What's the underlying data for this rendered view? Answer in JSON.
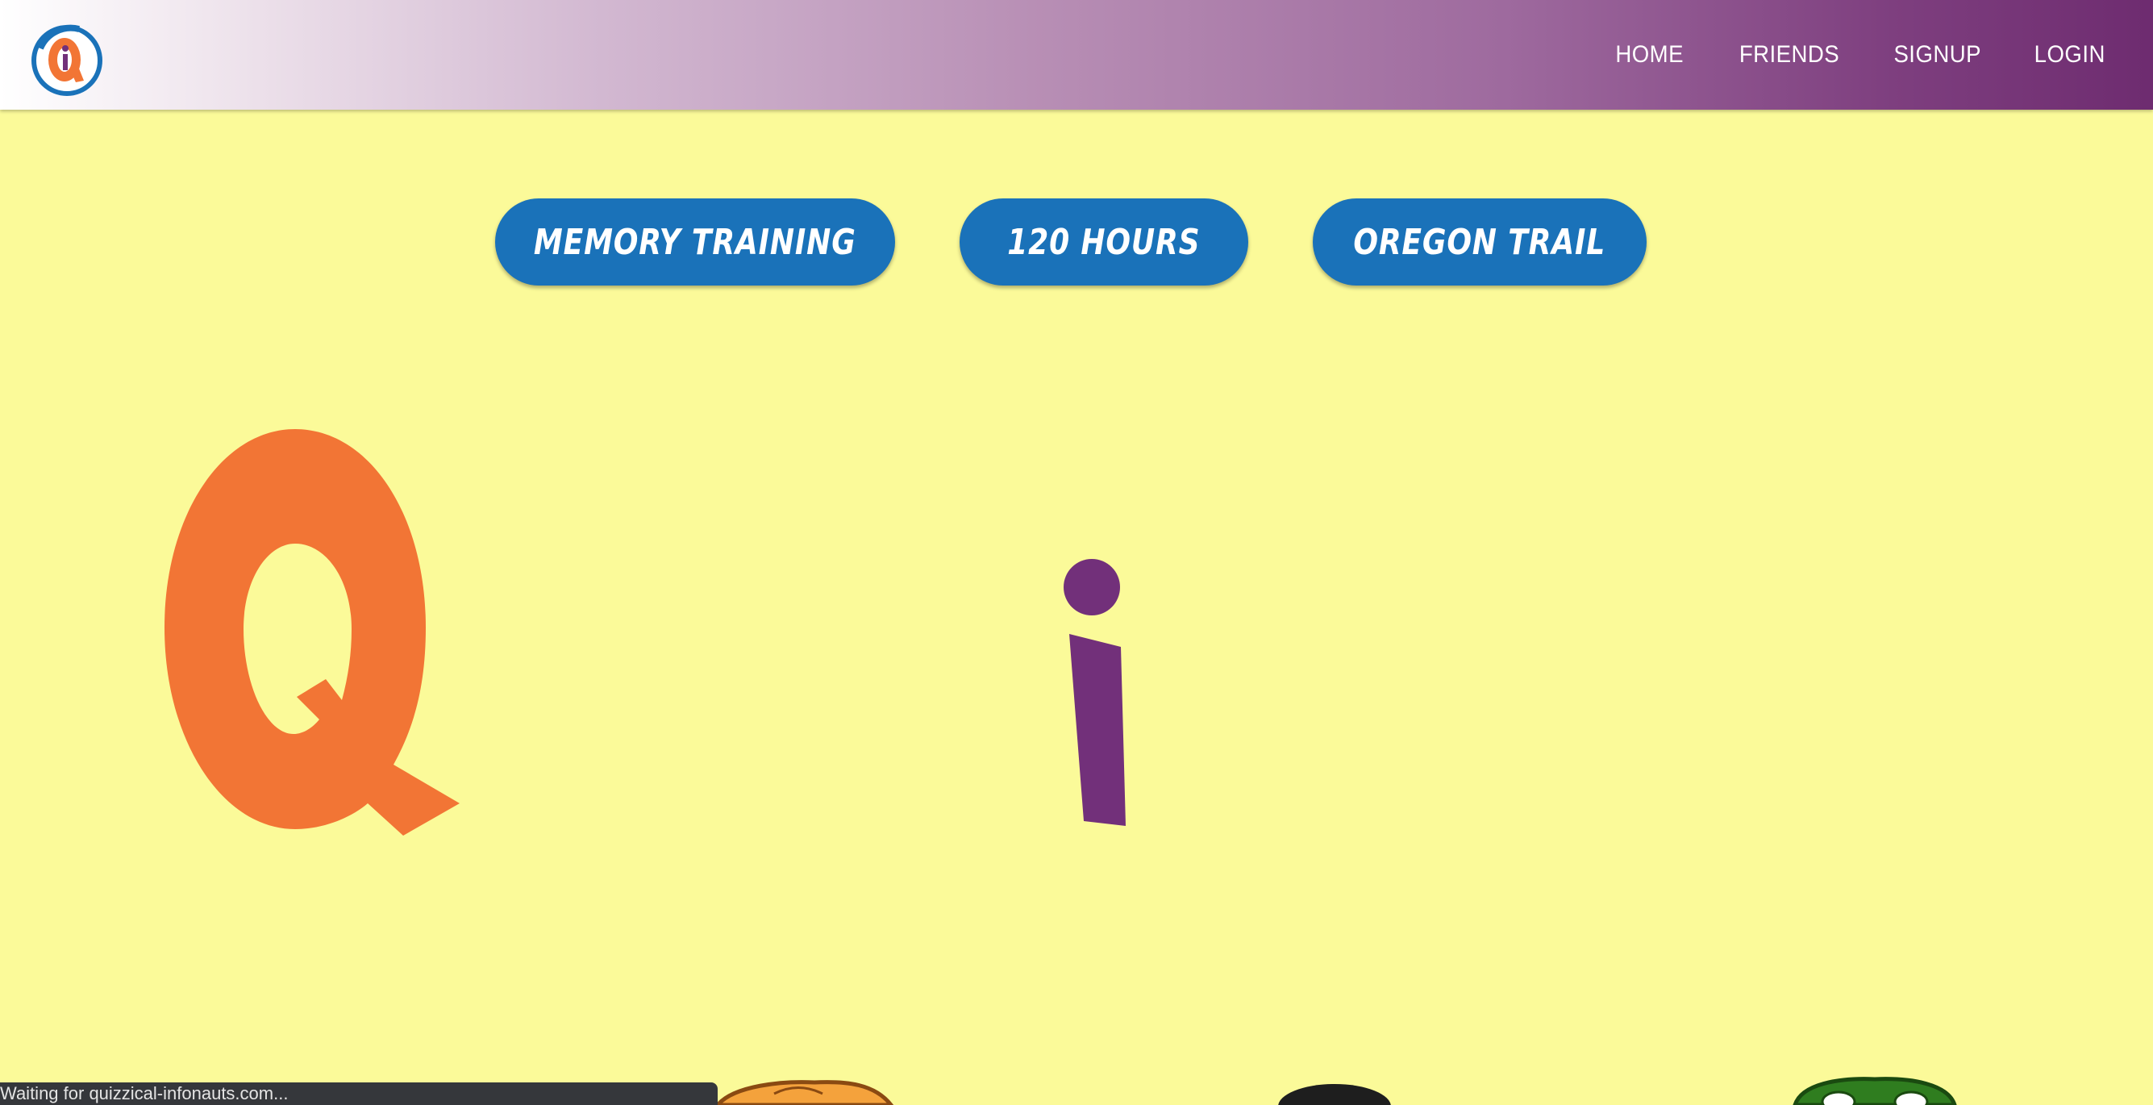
{
  "nav": {
    "home": "HOME",
    "friends": "FRIENDS",
    "signup": "SIGNUP",
    "login": "LOGIN"
  },
  "buttons": {
    "memory_training": "MEMORY TRAINING",
    "hours_120": "120 HOURS",
    "oregon_trail": "OREGON TRAIL"
  },
  "hero": {
    "letter_q": "Q",
    "letter_i": "i"
  },
  "status": {
    "text": "Waiting for quizzical-infonauts.com..."
  },
  "colors": {
    "background": "#fbfa99",
    "button_blue": "#1a72b9",
    "orange": "#f27535",
    "purple": "#72307a"
  }
}
